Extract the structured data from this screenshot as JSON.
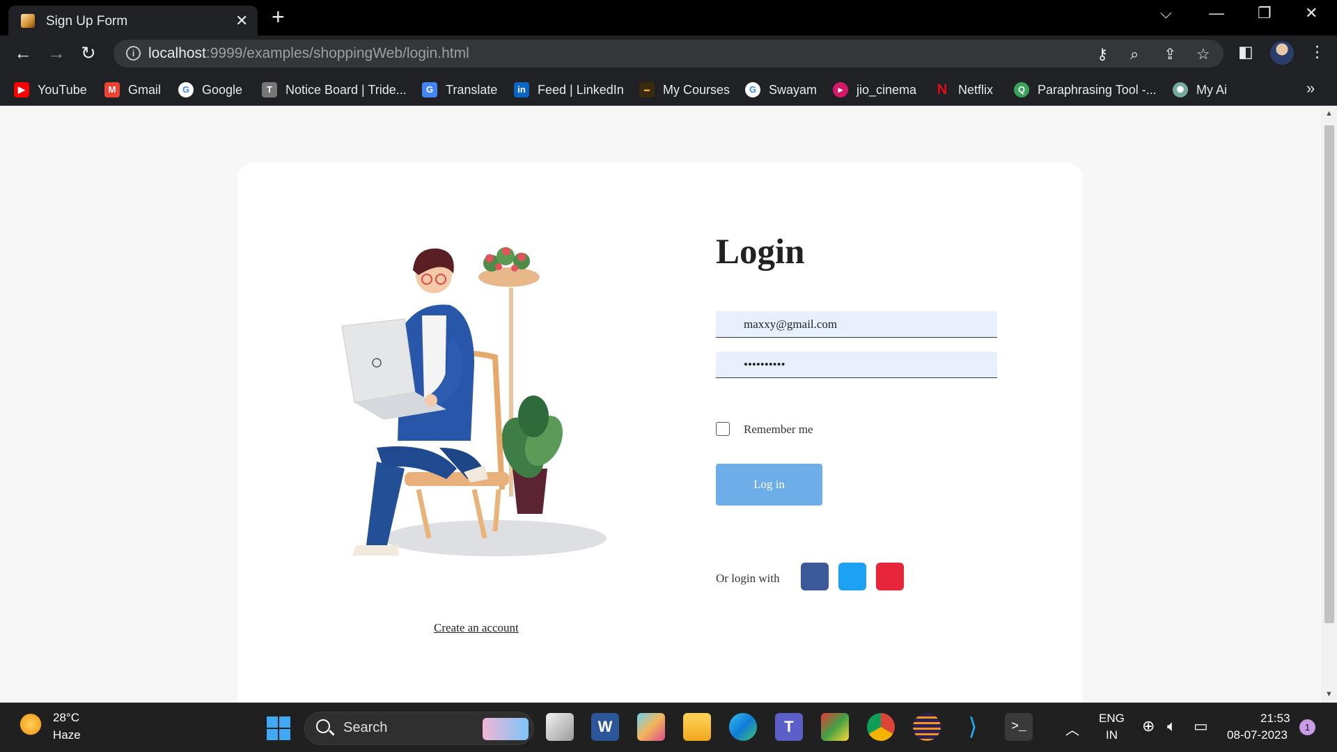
{
  "browser": {
    "tab_title": "Sign Up Form",
    "tab_close": "✕",
    "new_tab": "+",
    "window_controls": [
      "⌵",
      "—",
      "❐",
      "✕"
    ],
    "url_host": "localhost",
    "url_path": ":9999/examples/shoppingWeb/login.html"
  },
  "bookmarks": [
    {
      "label": "YouTube",
      "icon": "youtube-icon",
      "color": "#ff0000"
    },
    {
      "label": "Gmail",
      "icon": "gmail-icon",
      "color": "#ea4335"
    },
    {
      "label": "Google",
      "icon": "google-icon",
      "color": "#4285f4"
    },
    {
      "label": "Notice Board | Tride...",
      "icon": "notice-board-icon",
      "color": "#777777"
    },
    {
      "label": "Translate",
      "icon": "translate-icon",
      "color": "#4285f4"
    },
    {
      "label": "Feed | LinkedIn",
      "icon": "linkedin-icon",
      "color": "#0a66c2"
    },
    {
      "label": "My Courses",
      "icon": "courses-icon",
      "color": "#f5a623"
    },
    {
      "label": "Swayam",
      "icon": "swayam-icon",
      "color": "#4285f4"
    },
    {
      "label": "jio_cinema",
      "icon": "jio-cinema-icon",
      "color": "#d6186b"
    },
    {
      "label": "Netflix",
      "icon": "netflix-icon",
      "color": "#e50914"
    },
    {
      "label": "Paraphrasing Tool -...",
      "icon": "paraphrasing-icon",
      "color": "#3aa35a"
    },
    {
      "label": "My Ai",
      "icon": "openai-icon",
      "color": "#74aa9c"
    }
  ],
  "bookmarks_more": "»",
  "login": {
    "title": "Login",
    "email_value": "maxxy@gmail.com",
    "password_value": "••••••••••",
    "remember_label": "Remember me",
    "button_label": "Log in",
    "or_login_with": "Or login with",
    "create_account": "Create an account",
    "social": [
      {
        "name": "facebook",
        "color": "#3b5998"
      },
      {
        "name": "twitter",
        "color": "#1da1f2"
      },
      {
        "name": "google",
        "color": "#e8263a"
      }
    ]
  },
  "taskbar": {
    "temperature": "28°C",
    "weather": "Haze",
    "search_label": "Search",
    "language_line1": "ENG",
    "language_line2": "IN",
    "time": "21:53",
    "date": "08-07-2023",
    "notifications": "1"
  }
}
